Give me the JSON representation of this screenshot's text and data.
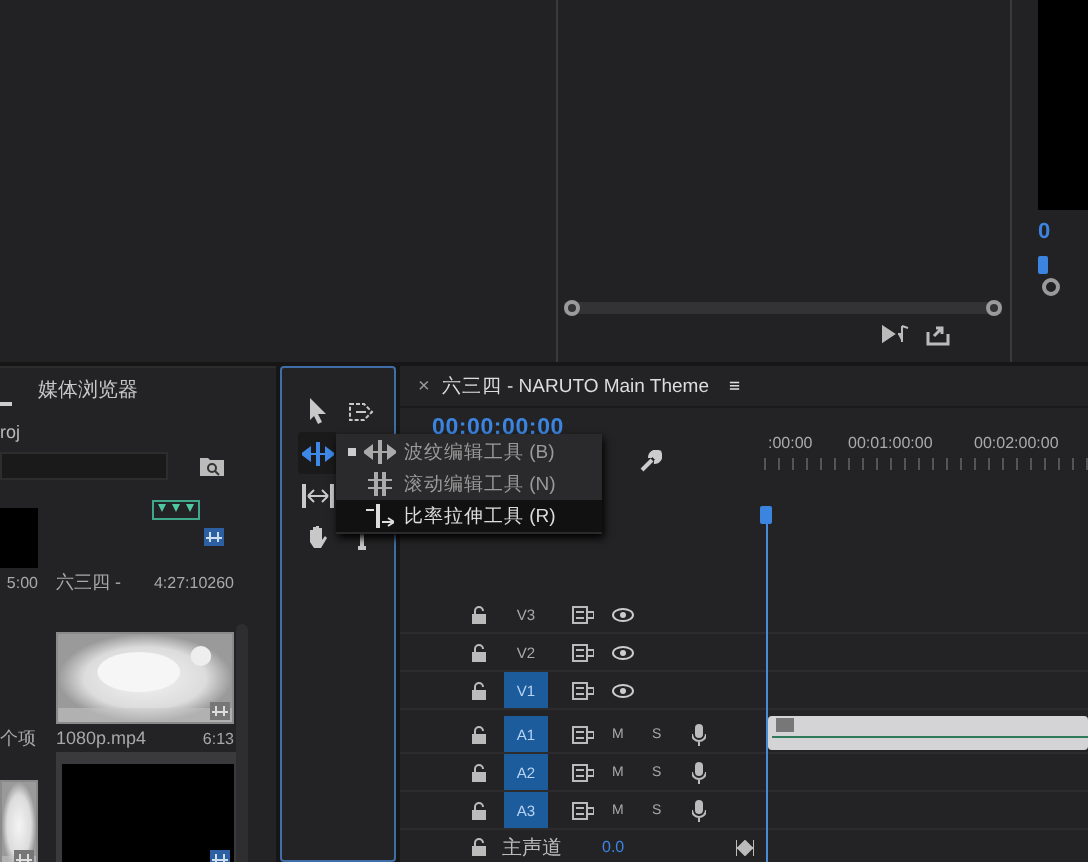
{
  "right_panel": {
    "timecode": "0"
  },
  "project_panel": {
    "tab": "媒体浏览器",
    "path": "roj",
    "tiles": [
      {
        "kind": "black",
        "duration": "5:00",
        "selected": false
      },
      {
        "kind": "audio",
        "name": "六三四 -",
        "duration": "4:27:10260",
        "selected": false
      },
      {
        "kind": "none",
        "name": "个项",
        "selected": false
      },
      {
        "kind": "light",
        "name": "1080p.mp4",
        "duration": "6:13",
        "selected": false
      },
      {
        "kind": "light",
        "selected": false
      },
      {
        "kind": "black",
        "selected": true
      }
    ]
  },
  "tools": [
    {
      "kind": "selection",
      "selected": false
    },
    {
      "kind": "track-select",
      "selected": false
    },
    {
      "kind": "ripple",
      "selected": true
    },
    {
      "kind": "slip",
      "selected": false
    },
    {
      "kind": "hand",
      "selected": false
    },
    {
      "kind": "type",
      "selected": false
    }
  ],
  "tool_menu": [
    {
      "kind": "ripple",
      "label": "波纹编辑工具 (B)",
      "checked": true,
      "highlighted": false
    },
    {
      "kind": "rolling",
      "label": "滚动编辑工具 (N)",
      "checked": false,
      "highlighted": false
    },
    {
      "kind": "rate-stretch",
      "label": "比率拉伸工具 (R)",
      "checked": false,
      "highlighted": true
    }
  ],
  "timeline": {
    "close": "×",
    "title": "六三四 - NARUTO Main Theme",
    "menu": "≡",
    "timecode": "00:00:00:00",
    "ruler": [
      ":00:00",
      "00:01:00:00",
      "00:02:00:00"
    ],
    "tracks": [
      {
        "kind": "video",
        "label": "V3",
        "targeted": false
      },
      {
        "kind": "video",
        "label": "V2",
        "targeted": false
      },
      {
        "kind": "video",
        "label": "V1",
        "targeted": true
      },
      {
        "kind": "audio",
        "label": "A1",
        "targeted": true,
        "mute": "M",
        "solo": "S",
        "clip": true
      },
      {
        "kind": "audio",
        "label": "A2",
        "targeted": true,
        "mute": "M",
        "solo": "S",
        "clip": false
      },
      {
        "kind": "audio",
        "label": "A3",
        "targeted": true,
        "mute": "M",
        "solo": "S",
        "clip": false
      }
    ],
    "master": {
      "label": "主声道",
      "value": "0.0"
    }
  }
}
